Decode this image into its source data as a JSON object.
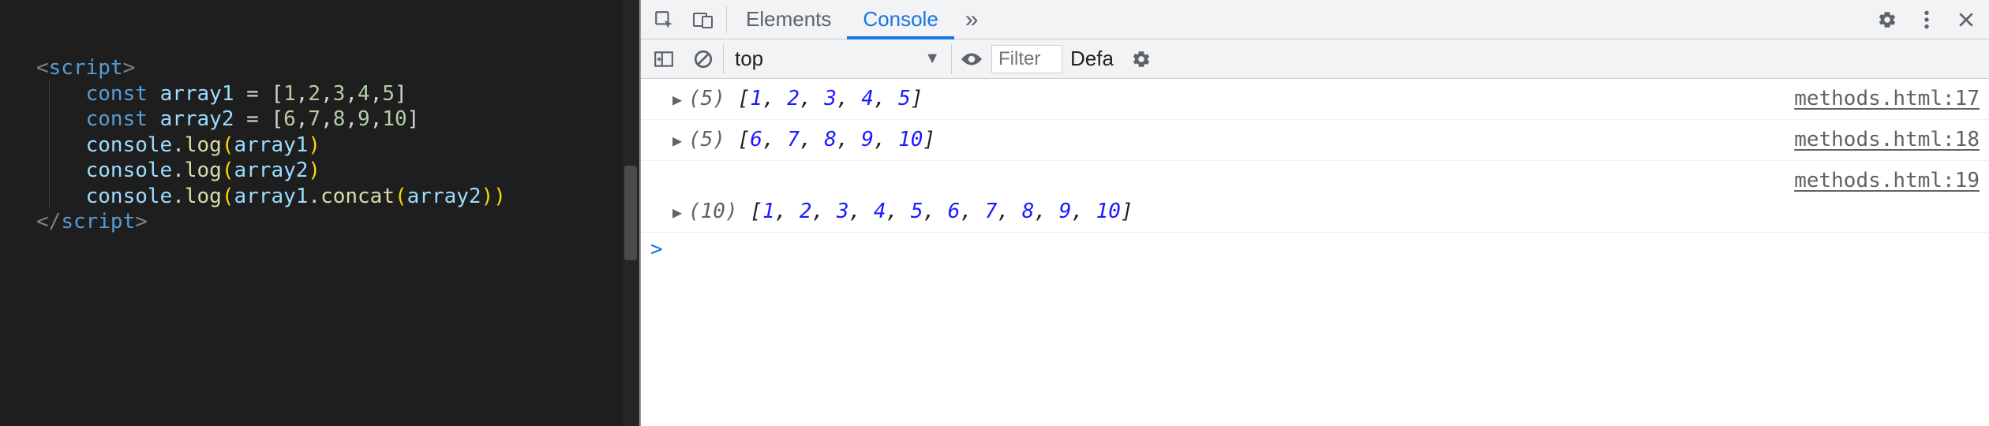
{
  "editor": {
    "code_lines": [
      {
        "type": "tag_open",
        "name": "script"
      },
      {
        "type": "decl",
        "kw": "const",
        "var": "array1",
        "value": "[1,2,3,4,5]"
      },
      {
        "type": "decl",
        "kw": "const",
        "var": "array2",
        "value": "[6,7,8,9,10]"
      },
      {
        "type": "call",
        "obj": "console",
        "fn": "log",
        "args": "array1"
      },
      {
        "type": "call",
        "obj": "console",
        "fn": "log",
        "args": "array2"
      },
      {
        "type": "call",
        "obj": "console",
        "fn": "log",
        "args": "array1.concat(array2)"
      },
      {
        "type": "tag_close",
        "name": "script"
      }
    ]
  },
  "devtools": {
    "tabs": {
      "elements": "Elements",
      "console": "Console",
      "more": "»"
    },
    "toolbar": {
      "context": "top",
      "filter_placeholder": "Filter",
      "levels": "Defa"
    },
    "logs": [
      {
        "length": 5,
        "values": [
          1,
          2,
          3,
          4,
          5
        ],
        "source": "methods.html:17"
      },
      {
        "length": 5,
        "values": [
          6,
          7,
          8,
          9,
          10
        ],
        "source": "methods.html:18"
      },
      {
        "length": 10,
        "values": [
          1,
          2,
          3,
          4,
          5,
          6,
          7,
          8,
          9,
          10
        ],
        "source": "methods.html:19",
        "tall": true
      }
    ],
    "prompt": ">"
  }
}
